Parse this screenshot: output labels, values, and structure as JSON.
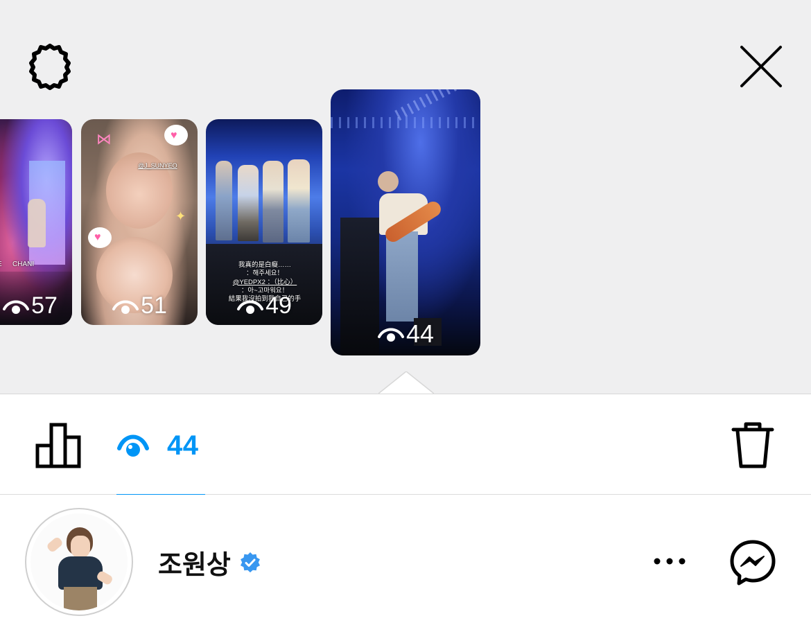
{
  "top_bar": {
    "settings_icon": "gear-icon",
    "close_icon": "close-icon"
  },
  "stories": [
    {
      "views": "57",
      "overlay_text": "CHANI",
      "overlay_text_2": "E"
    },
    {
      "views": "51",
      "overlay_text": "@J_SUNYEO"
    },
    {
      "views": "49",
      "overlay_lines": [
        "我真的是白癡……",
        "：해주세요！",
        "@YEDPX2 ：（比心）",
        "：아~고마워요！",
        "結果我沒拍到我自己的手"
      ]
    },
    {
      "views": "44",
      "overlay_text": ""
    }
  ],
  "toolbar": {
    "stats_icon": "bar-chart-icon",
    "viewers_icon": "eye-icon",
    "viewers_count": "44",
    "delete_icon": "trash-icon"
  },
  "viewer": {
    "username": "조원상",
    "verified": true,
    "more_icon": "more-dots-icon",
    "message_icon": "messenger-icon"
  },
  "colors": {
    "accent": "#0095f6",
    "verified": "#3897f0",
    "top_background": "#efeff0"
  }
}
